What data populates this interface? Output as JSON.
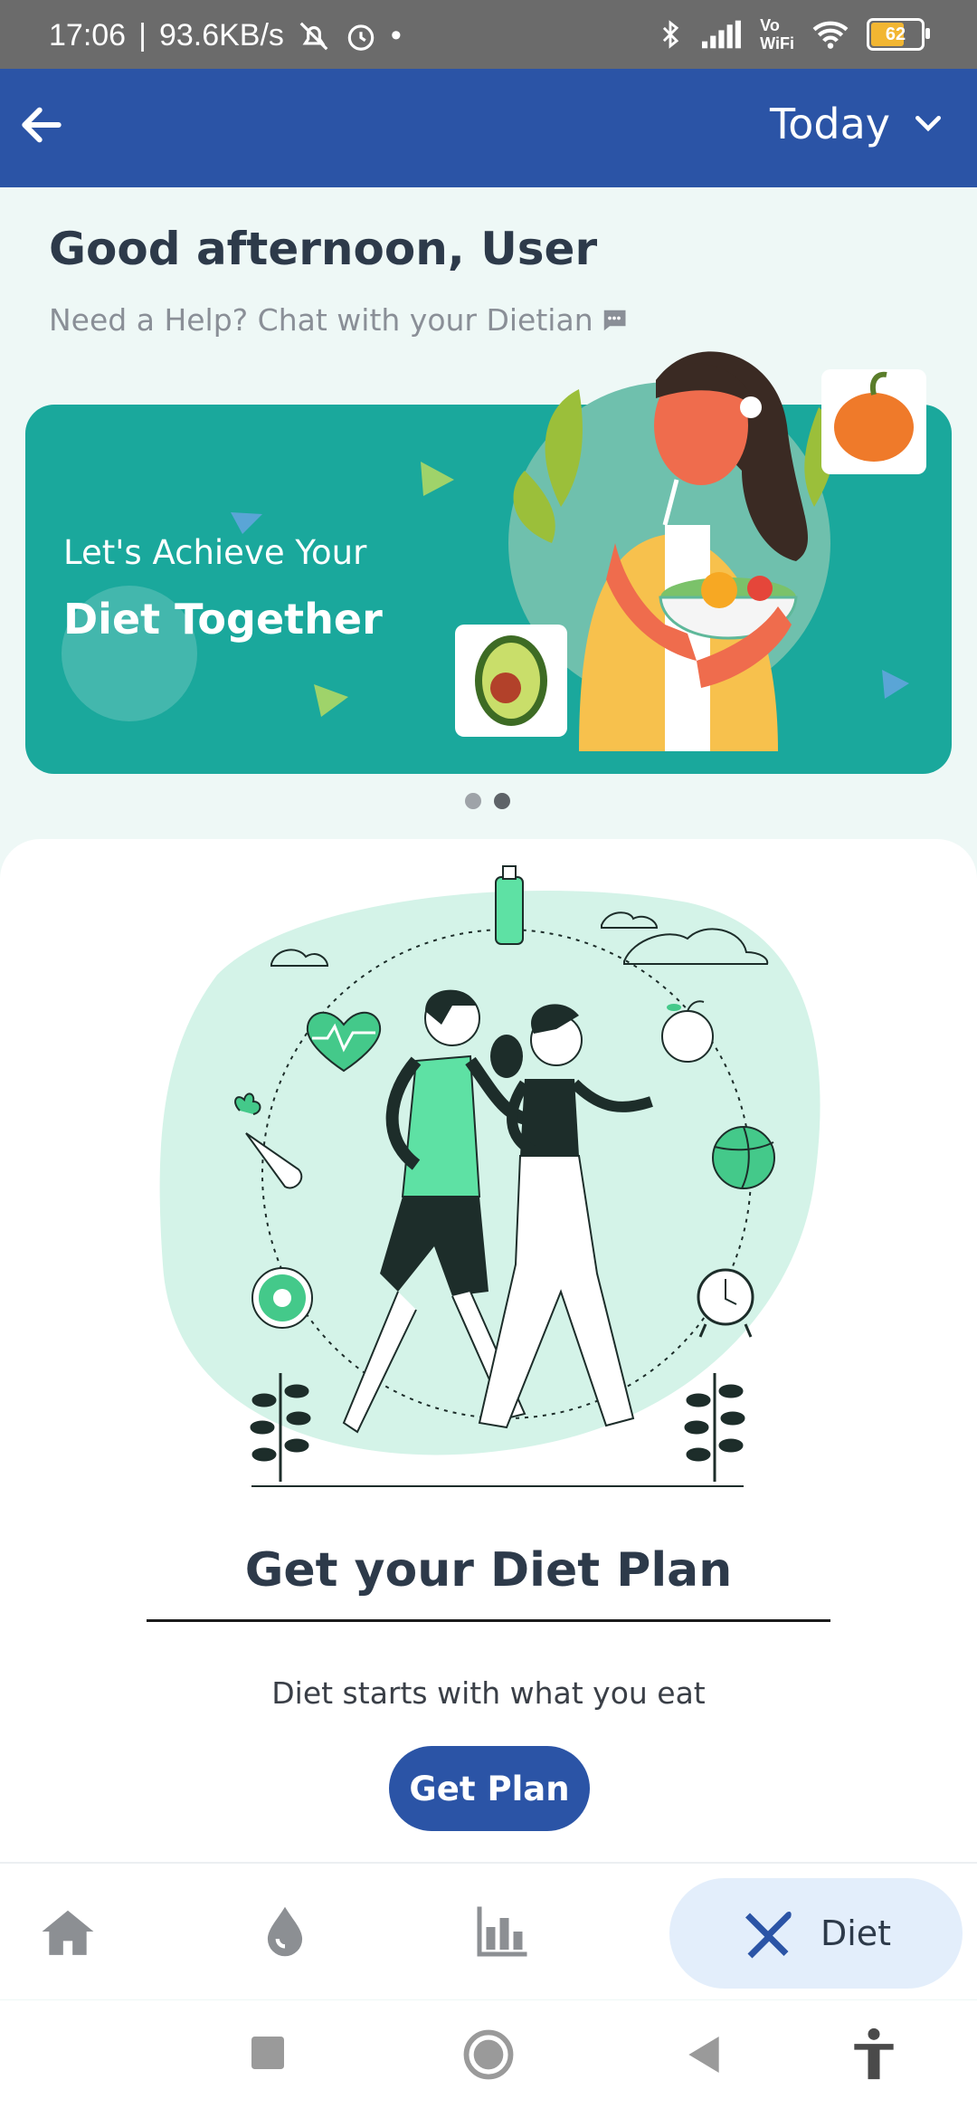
{
  "status_bar": {
    "time": "17:06",
    "speed": "93.6KB/s",
    "volte": "Vo",
    "wifi_label": "WiFi",
    "battery": "62"
  },
  "app_bar": {
    "back_icon": "arrow-left-icon",
    "date_range": "Today"
  },
  "greeting": {
    "title": "Good afternoon, User",
    "help_text": "Need a Help? Chat with your Dietian"
  },
  "banner": {
    "line1": "Let's Achieve Your",
    "line2": "Diet Together",
    "carousel": {
      "count": 2,
      "active": 2
    }
  },
  "plan_card": {
    "title": "Get your Diet Plan",
    "subtitle": "Diet starts with what you eat",
    "button": "Get Plan"
  },
  "bottom_nav": {
    "items": [
      {
        "icon": "home-icon",
        "label": ""
      },
      {
        "icon": "water-drop-icon",
        "label": ""
      },
      {
        "icon": "bar-chart-icon",
        "label": ""
      },
      {
        "icon": "fork-knife-icon",
        "label": "Diet",
        "selected": true
      }
    ]
  },
  "colors": {
    "primary": "#2b54a6",
    "banner": "#1aa89c",
    "background": "#eef8f6",
    "nav_selected": "#e3eefb"
  }
}
